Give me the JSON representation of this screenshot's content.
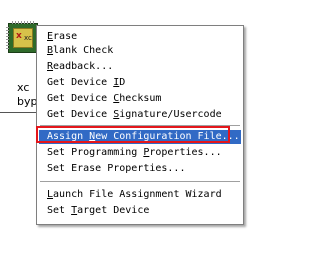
{
  "canvas": {
    "device_label_line1": "xc",
    "device_label_line2": "byp",
    "chip_mark": "x",
    "chip_mark_2": "xc"
  },
  "context_menu": {
    "items": [
      {
        "pre": "",
        "key": "E",
        "post": "rase"
      },
      {
        "pre": "",
        "key": "B",
        "post": "lank Check"
      },
      {
        "pre": "",
        "key": "R",
        "post": "eadback..."
      },
      {
        "pre": "Get Device ",
        "key": "I",
        "post": "D"
      },
      {
        "pre": "Get Device ",
        "key": "C",
        "post": "hecksum"
      },
      {
        "pre": "Get Device ",
        "key": "S",
        "post": "ignature/Usercode"
      },
      {
        "pre": "Assign ",
        "key": "N",
        "post": "ew Configuration File..."
      },
      {
        "pre": "Set Programming ",
        "key": "P",
        "post": "roperties..."
      },
      {
        "pre": "Set Erase Properties...",
        "key": "",
        "post": ""
      },
      {
        "pre": "",
        "key": "L",
        "post": "aunch File Assignment Wizard"
      },
      {
        "pre": "Set ",
        "key": "T",
        "post": "arget Device"
      }
    ],
    "highlighted_index": 6,
    "highlight_color": "#316ac5",
    "annotation_box_color": "#e4161b"
  }
}
